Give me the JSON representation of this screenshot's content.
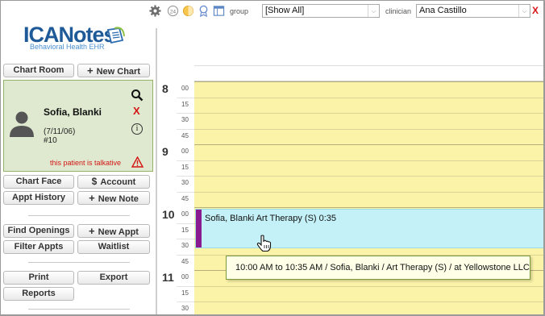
{
  "toolbar": {
    "group_label": "group",
    "group_value": "[Show All]",
    "clinician_label": "clinician",
    "clinician_value": "Ana Castillo",
    "close_label": "X",
    "badge_24": "24"
  },
  "logo": {
    "name": "ICANotes",
    "tagline": "Behavioral Health EHR"
  },
  "left_buttons": {
    "chart_room": "Chart Room",
    "new_chart": "New Chart",
    "chart_face": "Chart Face",
    "account": "Account",
    "appt_history": "Appt History",
    "new_note": "New Note",
    "find_openings": "Find Openings",
    "new_appt": "New Appt",
    "filter_appts": "Filter Appts",
    "waitlist": "Waitlist",
    "print": "Print",
    "export": "Export",
    "reports": "Reports"
  },
  "patient": {
    "name": "Sofia, Blanki",
    "dob": "(7/11/06)",
    "number": "#10",
    "remove_label": "X",
    "info_label": "i",
    "alert": "this patient is talkative"
  },
  "calendar": {
    "hours": [
      {
        "hour": "8",
        "minutes": [
          "00",
          "15",
          "30",
          "45"
        ]
      },
      {
        "hour": "9",
        "minutes": [
          "00",
          "15",
          "30",
          "45"
        ]
      },
      {
        "hour": "10",
        "minutes": [
          "00",
          "15",
          "30",
          "45"
        ]
      },
      {
        "hour": "11",
        "minutes": [
          "00",
          "15",
          "30"
        ]
      }
    ],
    "appointment": {
      "label": "Sofia, Blanki Art Therapy (S) 0:35",
      "bar_color": "#8a1a8f",
      "bg_color": "#c4f1f7"
    },
    "tooltip": "10:00 AM to 10:35 AM / Sofia, Blanki / Art Therapy (S) / at Yellowstone LLC"
  },
  "colors": {
    "calendar_bg": "#fbf3a8",
    "patient_card_bg": "#dfe9cf",
    "alert": "#d41515",
    "brand": "#1e5a98"
  }
}
